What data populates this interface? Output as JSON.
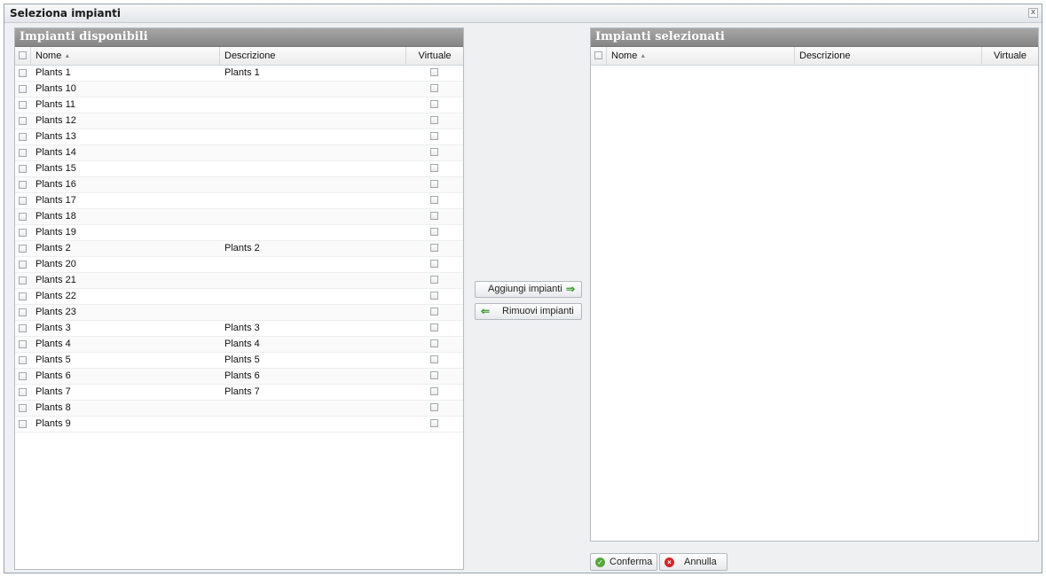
{
  "window": {
    "title": "Seleziona impianti",
    "close_glyph": "x"
  },
  "available": {
    "title": "Impianti disponibili",
    "columns": {
      "name": "Nome",
      "description": "Descrizione",
      "virtual": "Virtuale"
    },
    "sort_indicator": "▲",
    "rows": [
      {
        "name": "Plants 1",
        "description": "Plants 1"
      },
      {
        "name": "Plants 10",
        "description": ""
      },
      {
        "name": "Plants 11",
        "description": ""
      },
      {
        "name": "Plants 12",
        "description": ""
      },
      {
        "name": "Plants 13",
        "description": ""
      },
      {
        "name": "Plants 14",
        "description": ""
      },
      {
        "name": "Plants 15",
        "description": ""
      },
      {
        "name": "Plants 16",
        "description": ""
      },
      {
        "name": "Plants 17",
        "description": ""
      },
      {
        "name": "Plants 18",
        "description": ""
      },
      {
        "name": "Plants 19",
        "description": ""
      },
      {
        "name": "Plants 2",
        "description": "Plants 2"
      },
      {
        "name": "Plants 20",
        "description": ""
      },
      {
        "name": "Plants 21",
        "description": ""
      },
      {
        "name": "Plants 22",
        "description": ""
      },
      {
        "name": "Plants 23",
        "description": ""
      },
      {
        "name": "Plants 3",
        "description": "Plants 3"
      },
      {
        "name": "Plants 4",
        "description": "Plants 4"
      },
      {
        "name": "Plants 5",
        "description": "Plants 5"
      },
      {
        "name": "Plants 6",
        "description": "Plants 6"
      },
      {
        "name": "Plants 7",
        "description": "Plants 7"
      },
      {
        "name": "Plants 8",
        "description": ""
      },
      {
        "name": "Plants 9",
        "description": ""
      }
    ]
  },
  "selected": {
    "title": "Impianti selezionati",
    "columns": {
      "name": "Nome",
      "description": "Descrizione",
      "virtual": "Virtuale"
    },
    "sort_indicator": "▲",
    "rows": []
  },
  "actions": {
    "add_label": "Aggiungi impianti",
    "remove_label": "Rimuovi impianti"
  },
  "footer": {
    "confirm_label": "Conferma",
    "cancel_label": "Annulla"
  },
  "icons": {
    "add": "arrow-right-icon",
    "remove": "arrow-left-icon",
    "confirm": "check-circle-icon",
    "cancel": "cancel-circle-icon"
  },
  "colors": {
    "panel_header": "#8f8f8f",
    "arrow": "#3c9a2f",
    "confirm": "#57a83c",
    "cancel": "#d8232a"
  }
}
